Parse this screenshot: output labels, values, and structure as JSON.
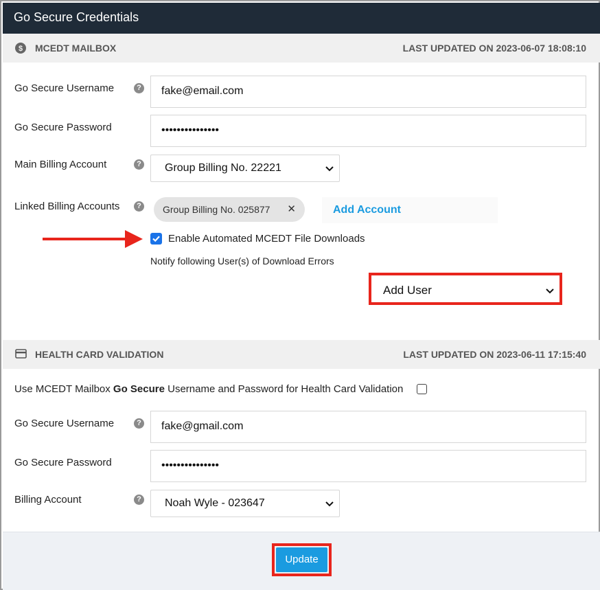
{
  "title": "Go Secure Credentials",
  "mcedt": {
    "section_label": "MCEDT MAILBOX",
    "section_icon": "dollar-circle-icon",
    "last_updated": "LAST UPDATED ON 2023-06-07 18:08:10",
    "username_label": "Go Secure Username",
    "username_value": "fake@email.com",
    "password_label": "Go Secure Password",
    "password_value": "•••••••••••••••",
    "main_billing_label": "Main Billing Account",
    "main_billing_value": "Group Billing No. 22221",
    "linked_label": "Linked Billing Accounts",
    "linked_chip": "Group Billing No. 025877",
    "add_account": "Add Account",
    "enable_downloads_label": "Enable Automated MCEDT File Downloads",
    "enable_downloads_checked": true,
    "notify_label": "Notify following User(s) of Download Errors",
    "add_user": "Add User"
  },
  "health": {
    "section_label": "HEALTH CARD VALIDATION",
    "section_icon": "credit-card-icon",
    "last_updated": "LAST UPDATED ON 2023-06-11 17:15:40",
    "use_mcedt_prefix": "Use MCEDT Mailbox ",
    "use_mcedt_bold": "Go Secure",
    "use_mcedt_suffix": " Username and Password for Health Card Validation",
    "use_mcedt_checked": false,
    "username_label": "Go Secure Username",
    "username_value": "fake@gmail.com",
    "password_label": "Go Secure Password",
    "password_value": "•••••••••••••••",
    "billing_label": "Billing Account",
    "billing_value": "Noah Wyle - 023647"
  },
  "footer": {
    "update_label": "Update"
  },
  "help_icon_glyph": "?",
  "colors": {
    "header": "#1f2b38",
    "accent": "#1a9be0",
    "highlight": "#e8251c",
    "checkbox": "#1a73e8"
  }
}
